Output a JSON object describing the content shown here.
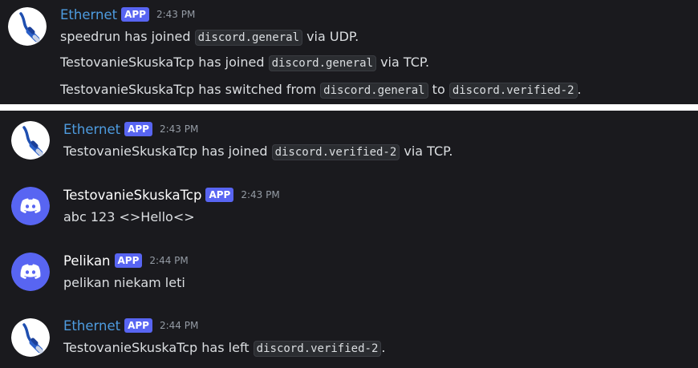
{
  "panel_top": {
    "message": {
      "author": "Ethernet",
      "badge": "APP",
      "time": "2:43 PM",
      "avatar_icon": "ethernet-cable-icon",
      "lines": [
        {
          "pre": "speedrun has joined ",
          "code1": "discord.general",
          "mid": " via UDP.",
          "code2": "",
          "post": ""
        },
        {
          "pre": "TestovanieSkuskaTcp has joined ",
          "code1": "discord.general",
          "mid": " via TCP.",
          "code2": "",
          "post": ""
        },
        {
          "pre": "TestovanieSkuskaTcp has switched from ",
          "code1": "discord.general",
          "mid": " to ",
          "code2": "discord.verified-2",
          "post": "."
        }
      ]
    }
  },
  "panel_bottom": {
    "messages": [
      {
        "author": "Ethernet",
        "badge": "APP",
        "time": "2:43 PM",
        "avatar_icon": "ethernet-cable-icon",
        "text_pre": "TestovanieSkuskaTcp has joined ",
        "code": "discord.verified-2",
        "text_post": " via TCP."
      },
      {
        "author": "TestovanieSkuskaTcp",
        "badge": "APP",
        "time": "2:43 PM",
        "avatar_icon": "discord-logo-icon",
        "text": "abc 123 <>Hello<>"
      },
      {
        "author": "Pelikan",
        "badge": "APP",
        "time": "2:44 PM",
        "avatar_icon": "discord-logo-icon",
        "text": "pelikan niekam leti"
      },
      {
        "author": "Ethernet",
        "badge": "APP",
        "time": "2:44 PM",
        "avatar_icon": "ethernet-cable-icon",
        "text_pre": "TestovanieSkuskaTcp has left ",
        "code": "discord.verified-2",
        "text_post": "."
      }
    ]
  },
  "colors": {
    "background": "#1a1a1e",
    "divider": "#ffffff",
    "ethernet_name": "#4e9ce0",
    "badge": "#5865f2",
    "discord_avatar": "#5865f2",
    "text": "#dbdee1",
    "timestamp": "#949ba4"
  }
}
